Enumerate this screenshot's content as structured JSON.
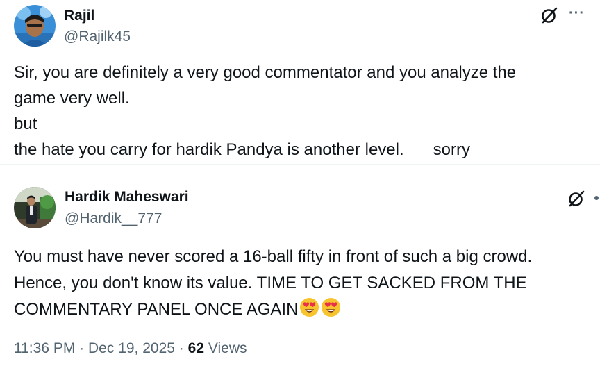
{
  "tweets": [
    {
      "author": {
        "display_name": "Rajil",
        "handle": "@Rajilk45",
        "avatar_icon": "avatar-rajil"
      },
      "text_lines": [
        "Sir, you are definitely a very good commentator and you analyze the",
        "game very well.",
        "but",
        "the hate you carry for hardik Pandya is another level."
      ],
      "text_trailing": "sorry",
      "actions": {
        "grok_icon": "grok-icon",
        "more_icon": "more-icon",
        "more_label": "···"
      }
    },
    {
      "author": {
        "display_name": "Hardik Maheswari",
        "handle": "@Hardik__777",
        "avatar_icon": "avatar-hardik"
      },
      "text_lines": [
        "You must have never scored a 16-ball fifty in front of such a big crowd.",
        "Hence, you don't know its value. TIME TO GET SACKED FROM THE",
        "COMMENTARY PANEL ONCE AGAIN"
      ],
      "emoji": [
        "smiling-face-with-heart-eyes",
        "smiling-face-with-heart-eyes"
      ],
      "meta": {
        "time": "11:36 PM",
        "separator": "·",
        "date": "Dec 19, 2025",
        "views_count": "62",
        "views_label": "Views"
      },
      "actions": {
        "grok_icon": "grok-icon"
      }
    }
  ],
  "colors": {
    "text_primary": "#0f1419",
    "text_secondary": "#536471",
    "divider": "#eff3f4",
    "background": "#ffffff"
  }
}
